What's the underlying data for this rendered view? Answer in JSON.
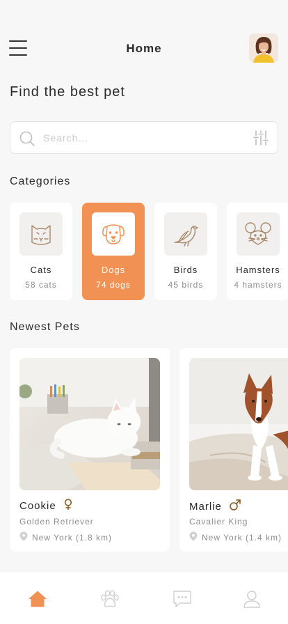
{
  "header": {
    "title": "Home"
  },
  "page_heading": "Find the best pet",
  "search": {
    "placeholder": "Search..."
  },
  "categories_title": "Categories",
  "categories": [
    {
      "name": "Cats",
      "count": "58 cats",
      "icon": "cat-face-icon",
      "active": false
    },
    {
      "name": "Dogs",
      "count": "74 dogs",
      "icon": "dog-face-icon",
      "active": true
    },
    {
      "name": "Birds",
      "count": "45 birds",
      "icon": "bird-icon",
      "active": false
    },
    {
      "name": "Hamsters",
      "count": "4 hamsters",
      "icon": "mouse-icon",
      "active": false
    }
  ],
  "newest_title": "Newest Pets",
  "pets": [
    {
      "name": "Cookie",
      "gender": "female",
      "breed": "Golden Retriever",
      "location": "New York (1.8 km)"
    },
    {
      "name": "Marlie",
      "gender": "male",
      "breed": "Cavalier King",
      "location": "New York (1.4 km)"
    }
  ],
  "tabs": [
    "home-icon",
    "paw-icon",
    "chat-icon",
    "user-icon"
  ],
  "colors": {
    "accent": "#f29154",
    "icon_brown": "#a8896b",
    "gender_brown": "#8a5a24"
  }
}
